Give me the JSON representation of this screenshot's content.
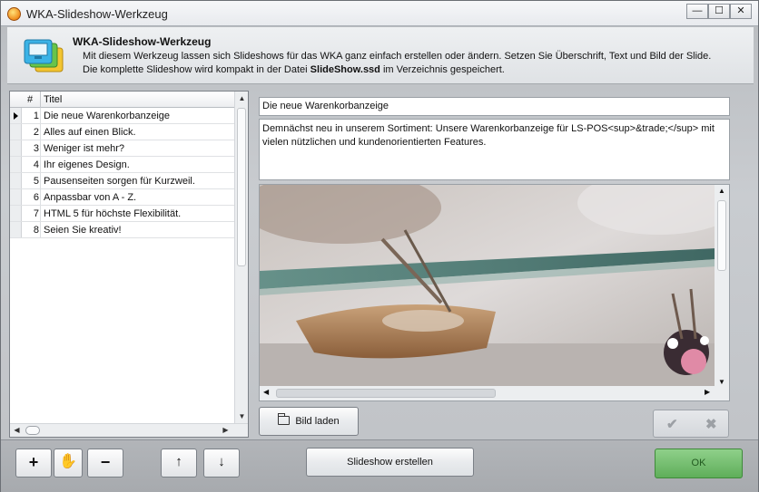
{
  "window": {
    "title": "WKA-Slideshow-Werkzeug",
    "controls": {
      "minimize": "—",
      "maximize": "☐",
      "close": "✕"
    }
  },
  "header": {
    "title": "WKA-Slideshow-Werkzeug",
    "line1": "Mit diesem Werkzeug lassen sich Slideshows für das WKA ganz einfach erstellen oder ändern. Setzen Sie Überschrift, Text und Bild der Slide.",
    "line2_prefix": "Die komplette Slideshow wird kompakt in der Datei ",
    "line2_file": "SlideShow.ssd",
    "line2_suffix": " im Verzeichnis gespeichert.",
    "icon": "slideshow-icon"
  },
  "slides": {
    "columns": {
      "num": "#",
      "title": "Titel"
    },
    "rows": [
      {
        "num": "1",
        "title": "Die neue Warenkorbanzeige",
        "selected": true
      },
      {
        "num": "2",
        "title": "Alles auf einen Blick."
      },
      {
        "num": "3",
        "title": "Weniger ist mehr?"
      },
      {
        "num": "4",
        "title": "Ihr eigenes Design."
      },
      {
        "num": "5",
        "title": "Pausenseiten sorgen für Kurzweil."
      },
      {
        "num": "6",
        "title": "Anpassbar von A - Z."
      },
      {
        "num": "7",
        "title": "HTML 5 für höchste Flexibilität."
      },
      {
        "num": "8",
        "title": "Seien Sie kreativ!"
      }
    ]
  },
  "editor": {
    "heading_value": "Die neue Warenkorbanzeige",
    "text_value": "Demnächst neu in unserem Sortiment: Unsere Warenkorbanzeige für LS-POS<sup>&trade;</sup> mit vielen nützlichen und kundenorientierten Features.",
    "load_image_label": "Bild laden",
    "confirm_icon": "✔",
    "cancel_icon": "✖"
  },
  "toolbar": {
    "add": "+",
    "hand": "✋",
    "remove": "−",
    "up": "↑",
    "down": "↓",
    "create_label": "Slideshow erstellen",
    "ok_label": "OK"
  }
}
